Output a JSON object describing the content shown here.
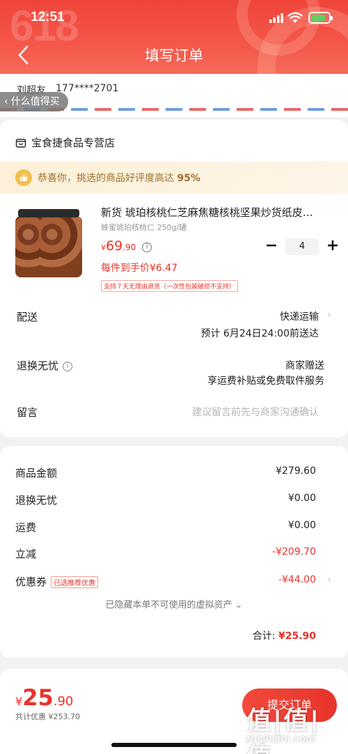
{
  "status": {
    "time": "12:51"
  },
  "header": {
    "title": "填写订单"
  },
  "address": {
    "name": "刘超友",
    "phone": "177****2701"
  },
  "floating_tag": {
    "label": "什么值得买"
  },
  "shop": {
    "name": "宝食捷食品专营店"
  },
  "congrats": {
    "text": "恭喜你，挑选的商品好评度高达",
    "percent": "95%"
  },
  "product": {
    "title": "新货 琥珀核桃仁芝麻焦糖核桃坚果炒货纸皮…",
    "spec": "蜂蜜琥珀核桃仁 250g/罐",
    "price_currency": "¥",
    "price_int": "69",
    "price_dec": ".90",
    "unit_price": "每件到手价¥6.47",
    "quantity": "4",
    "minus": "−",
    "plus": "+",
    "return_tag": "支持７天无理由退货（一次性包装破损不支持）"
  },
  "delivery": {
    "label": "配送",
    "method": "快递运输",
    "eta": "预计 6月24日24:00前送达"
  },
  "returns": {
    "label": "退换无忧",
    "value": "商家赠送",
    "detail": "享运费补贴或免费取件服务"
  },
  "message": {
    "label": "留言",
    "placeholder": "建议留言前先与商家沟通确认"
  },
  "summary": {
    "goods_label": "商品金额",
    "goods_value": "¥279.60",
    "returns_label": "退换无忧",
    "returns_value": "¥0.00",
    "shipping_label": "运费",
    "shipping_value": "¥0.00",
    "discount_label": "立减",
    "discount_value": "-¥209.70",
    "coupon_label": "优惠券",
    "coupon_tag": "已选推荐优惠",
    "coupon_value": "-¥44.00",
    "hidden_note": "已隐藏本单不可使用的虚拟资产",
    "total_label": "合计: ",
    "total_value": "¥25.90"
  },
  "bottom": {
    "currency": "¥",
    "int": "25",
    "dec": ".90",
    "saved": "共计优惠 ¥253.70",
    "submit": "提交订单"
  },
  "watermark": {
    "logo": "值|值|值",
    "url": "zhizhizhi.com"
  },
  "colors": {
    "accent": "#e8332a",
    "header": "#f0443a",
    "gold": "#a0702a"
  }
}
